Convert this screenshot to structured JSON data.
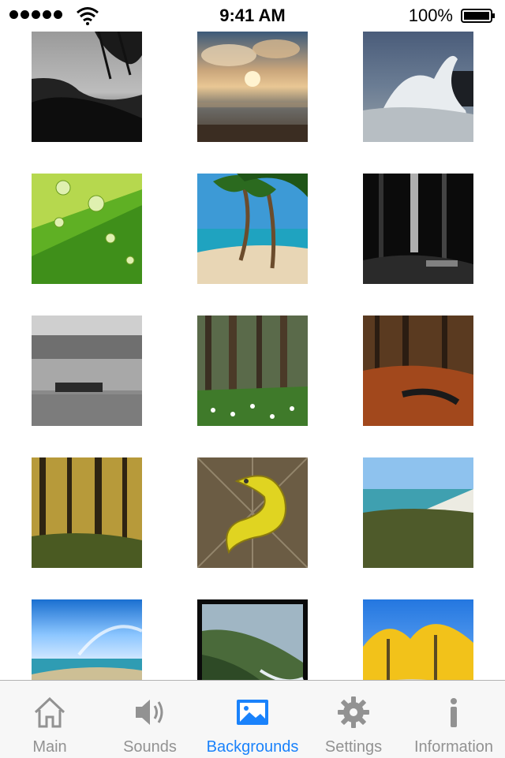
{
  "status_bar": {
    "time": "9:41 AM",
    "battery_percent": "100%",
    "signal_bars": 5,
    "wifi_icon": "wifi-icon",
    "battery_icon": "battery-full-icon"
  },
  "backgrounds": [
    {
      "subject": "bw-coastal-trees"
    },
    {
      "subject": "sunset-beach"
    },
    {
      "subject": "crashing-wave"
    },
    {
      "subject": "leaf-water-drops"
    },
    {
      "subject": "palm-beach"
    },
    {
      "subject": "dark-forest"
    },
    {
      "subject": "bw-rocky-shore"
    },
    {
      "subject": "forest-wildflowers"
    },
    {
      "subject": "autumn-forest-stream"
    },
    {
      "subject": "sunlit-forest"
    },
    {
      "subject": "banana-slug"
    },
    {
      "subject": "coastal-cliffs"
    },
    {
      "subject": "beach-blue-sky"
    },
    {
      "subject": "rocky-coastline"
    },
    {
      "subject": "golden-trees"
    }
  ],
  "tab_bar": {
    "active": "backgrounds",
    "accent_color": "#1a82fb",
    "inactive_color": "#929292",
    "tabs": [
      {
        "id": "main",
        "label": "Main",
        "icon": "home-icon"
      },
      {
        "id": "sounds",
        "label": "Sounds",
        "icon": "speaker-icon"
      },
      {
        "id": "backgrounds",
        "label": "Backgrounds",
        "icon": "picture-icon"
      },
      {
        "id": "settings",
        "label": "Settings",
        "icon": "gear-icon"
      },
      {
        "id": "information",
        "label": "Information",
        "icon": "info-icon"
      }
    ]
  }
}
